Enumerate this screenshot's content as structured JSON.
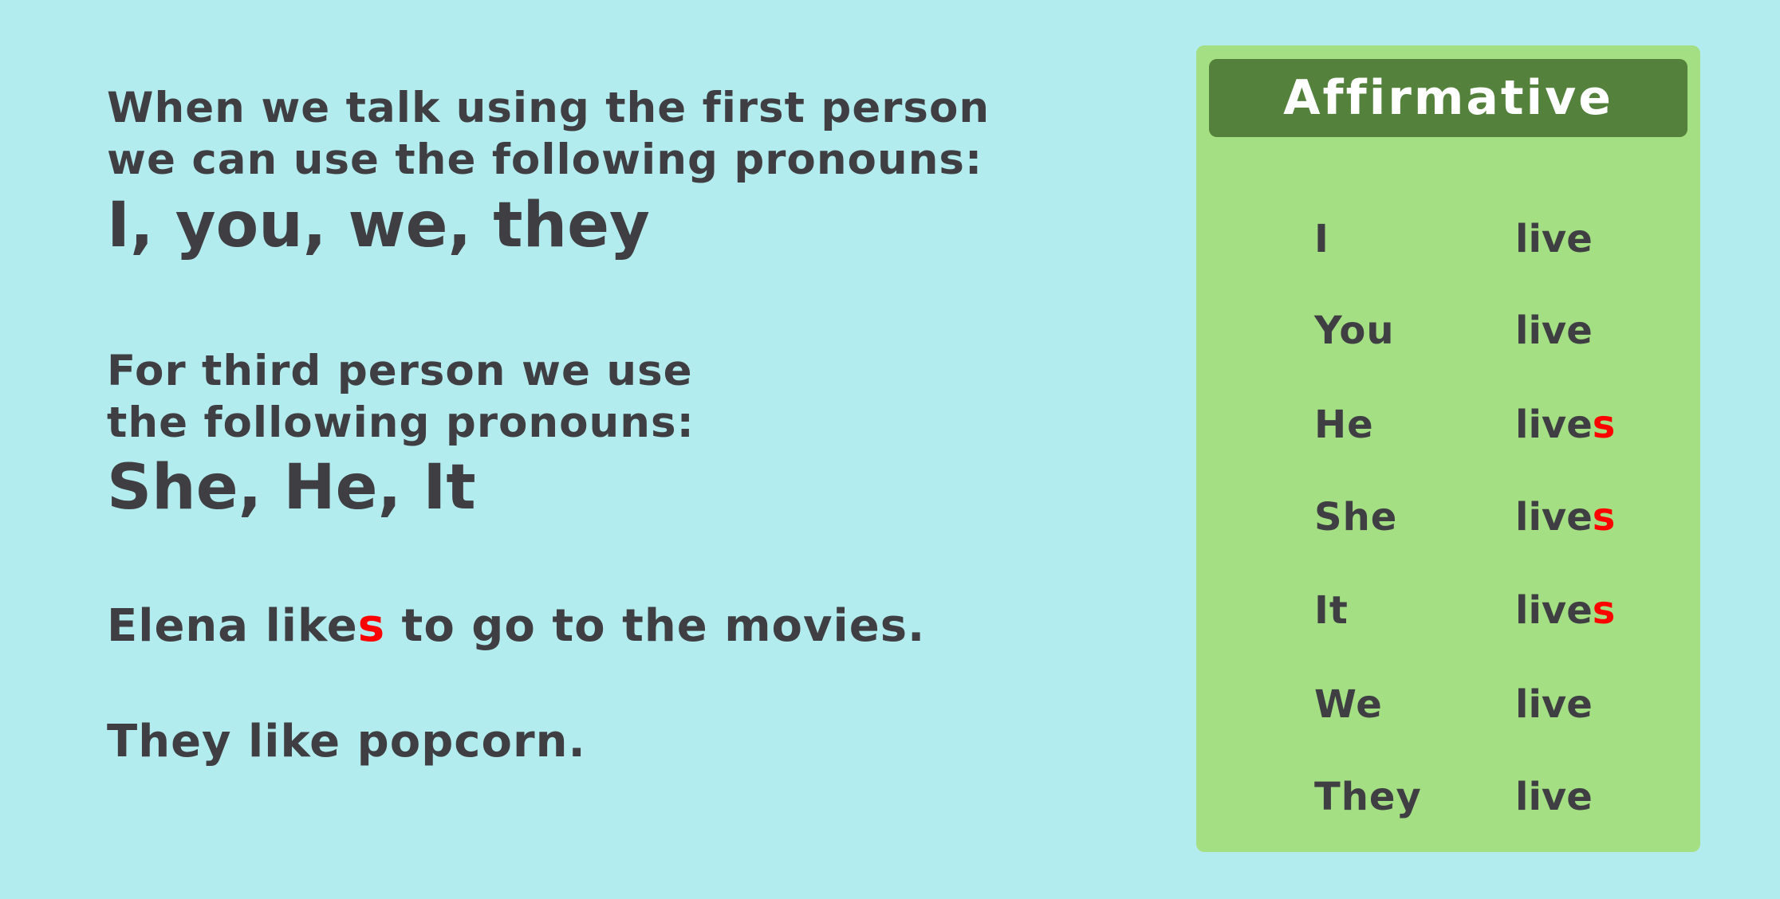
{
  "first_person": {
    "line1": "When we talk using the first person",
    "line2": " we can use the following pronouns:",
    "pronouns": "I, you, we, they"
  },
  "third_person": {
    "line1": "For third person we use",
    "line2": "the following pronouns:",
    "pronouns": "She, He, It"
  },
  "example1": {
    "subject": "Elena ",
    "verb_stem": "like",
    "verb_suffix": "s",
    "rest": " to go to the movies."
  },
  "example2": {
    "subject": "They ",
    "verb": "like",
    "rest": " popcorn."
  },
  "table": {
    "title": "Affirmative",
    "rows": [
      {
        "pronoun": "I",
        "verb": "live",
        "suffix": ""
      },
      {
        "pronoun": "You",
        "verb": "live",
        "suffix": ""
      },
      {
        "pronoun": "He",
        "verb": "live",
        "suffix": "s"
      },
      {
        "pronoun": "She",
        "verb": "live",
        "suffix": "s"
      },
      {
        "pronoun": "It",
        "verb": "live",
        "suffix": "s"
      },
      {
        "pronoun": "We",
        "verb": "live",
        "suffix": ""
      },
      {
        "pronoun": "They",
        "verb": "live",
        "suffix": ""
      }
    ]
  },
  "colors": {
    "background": "#b3ecee",
    "panel": "#a4df83",
    "header": "#54813b",
    "text": "#3f3f43",
    "highlight": "#ff0000"
  }
}
